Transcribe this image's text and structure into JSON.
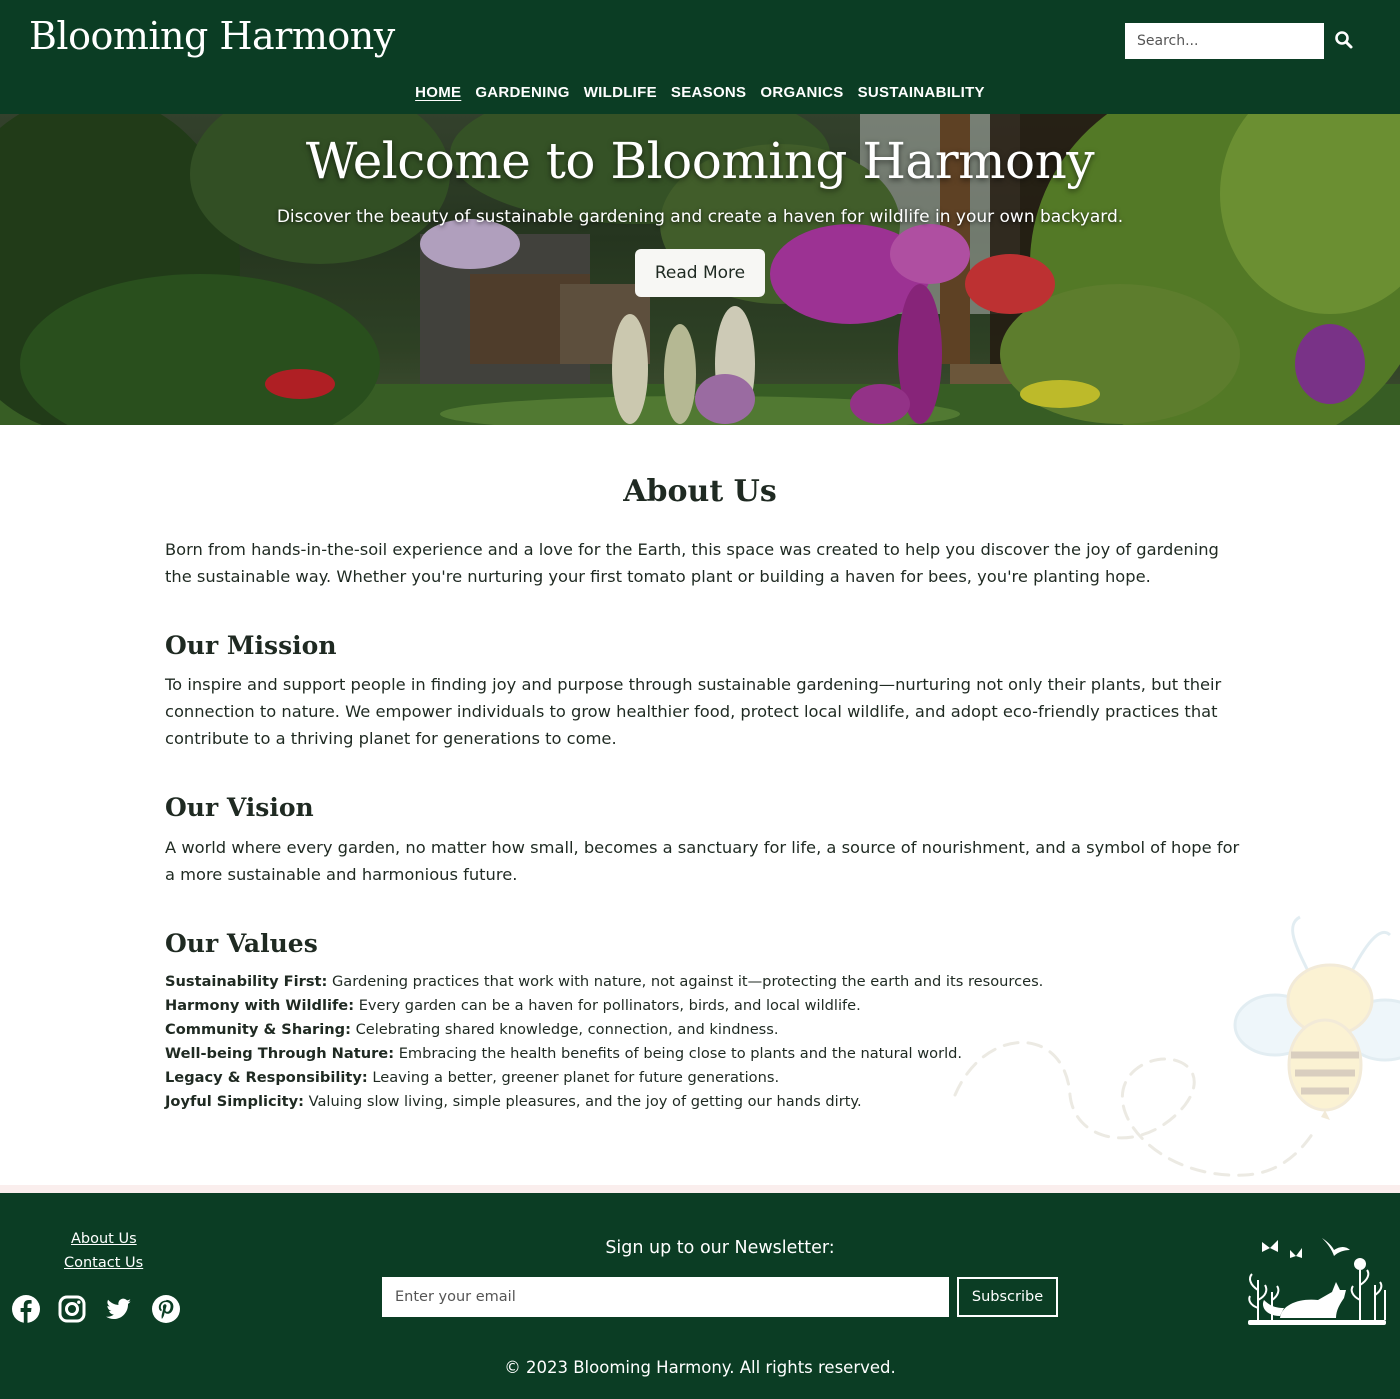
{
  "header": {
    "logo": "Blooming Harmony",
    "search_placeholder": "Search...",
    "nav": [
      {
        "label": "HOME",
        "active": true
      },
      {
        "label": "GARDENING",
        "active": false
      },
      {
        "label": "WILDLIFE",
        "active": false
      },
      {
        "label": "SEASONS",
        "active": false
      },
      {
        "label": "ORGANICS",
        "active": false
      },
      {
        "label": "SUSTAINABILITY",
        "active": false
      }
    ]
  },
  "hero": {
    "title": "Welcome to Blooming Harmony",
    "subtitle": "Discover the beauty of sustainable gardening and create a haven for wildlife in your own backyard.",
    "button": "Read More"
  },
  "about": {
    "heading": "About Us",
    "text": "Born from hands-in-the-soil experience and a love for the Earth, this space was created to help you discover the joy of gardening the sustainable way. Whether you're nurturing your first tomato plant or building a haven for bees, you're planting hope."
  },
  "mission": {
    "heading": "Our Mission",
    "text": "To inspire and support people in finding joy and purpose through sustainable gardening—nurturing not only their plants, but their connection to nature. We empower individuals to grow healthier food, protect local wildlife, and adopt eco-friendly practices that contribute to a thriving planet for generations to come."
  },
  "vision": {
    "heading": "Our Vision",
    "text": "A world where every garden, no matter how small, becomes a sanctuary for life, a source of nourishment, and a symbol of hope for a more sustainable and harmonious future."
  },
  "values": {
    "heading": "Our Values",
    "items": [
      {
        "title": "Sustainability First:",
        "text": "Gardening practices that work with nature, not against it—protecting the earth and its resources."
      },
      {
        "title": "Harmony with Wildlife:",
        "text": "Every garden can be a haven for pollinators, birds, and local wildlife."
      },
      {
        "title": "Community & Sharing:",
        "text": "Celebrating shared knowledge, connection, and kindness."
      },
      {
        "title": "Well-being Through Nature:",
        "text": "Embracing the health benefits of being close to plants and the natural world."
      },
      {
        "title": "Legacy & Responsibility:",
        "text": "Leaving a better, greener planet for future generations."
      },
      {
        "title": "Joyful Simplicity:",
        "text": "Valuing slow living, simple pleasures, and the joy of getting our hands dirty."
      }
    ]
  },
  "footer": {
    "links": [
      "About Us",
      "Contact Us"
    ],
    "social_icons": [
      "facebook-icon",
      "instagram-icon",
      "twitter-icon",
      "pinterest-icon"
    ],
    "newsletter_title": "Sign up to our Newsletter:",
    "email_placeholder": "Enter your email",
    "subscribe": "Subscribe",
    "copyright": "© 2023 Blooming Harmony. All rights reserved."
  },
  "colors": {
    "brand_green": "#0b3d24",
    "text": "#1f2a22",
    "footer_strip": "#faeeed"
  }
}
